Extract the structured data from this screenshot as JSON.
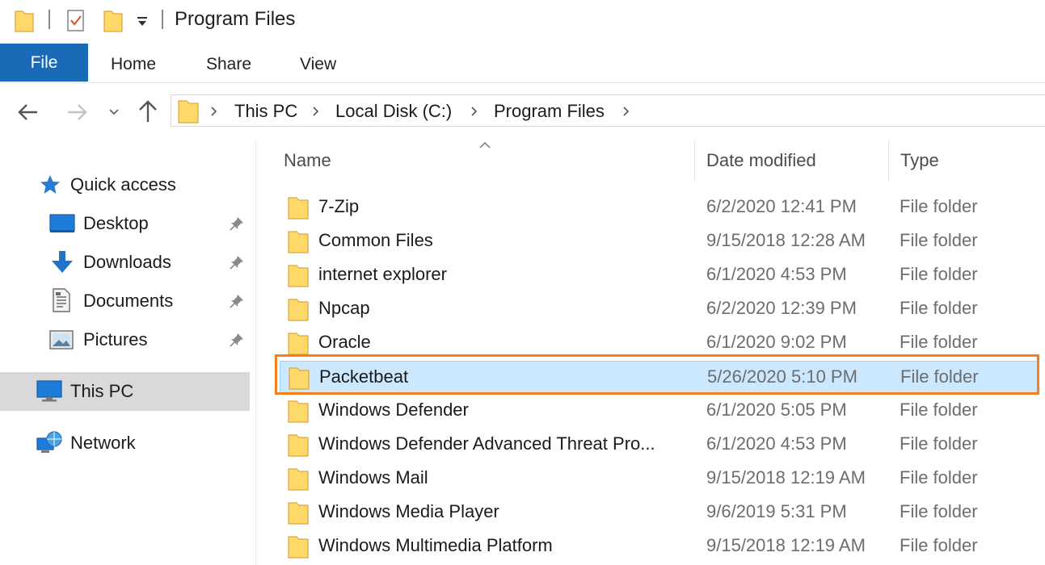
{
  "window": {
    "title": "Program Files"
  },
  "ribbon": {
    "tabs": [
      "File",
      "Home",
      "Share",
      "View"
    ]
  },
  "address": {
    "breadcrumbs": [
      "This PC",
      "Local Disk (C:)",
      "Program Files"
    ]
  },
  "sidebar": {
    "items": [
      {
        "label": "Quick access",
        "icon": "star-icon"
      },
      {
        "label": "Desktop",
        "icon": "desktop-icon",
        "pinned": true
      },
      {
        "label": "Downloads",
        "icon": "download-arrow-icon",
        "pinned": true
      },
      {
        "label": "Documents",
        "icon": "document-icon",
        "pinned": true
      },
      {
        "label": "Pictures",
        "icon": "pictures-icon",
        "pinned": true
      },
      {
        "label": "This PC",
        "icon": "computer-icon",
        "selected": true
      },
      {
        "label": "Network",
        "icon": "network-icon"
      }
    ]
  },
  "list": {
    "columns": [
      "Name",
      "Date modified",
      "Type"
    ],
    "sort_indicator": "ascending",
    "rows": [
      {
        "name": "7-Zip",
        "date": "6/2/2020 12:41 PM",
        "type": "File folder"
      },
      {
        "name": "Common Files",
        "date": "9/15/2018 12:28 AM",
        "type": "File folder"
      },
      {
        "name": "internet explorer",
        "date": "6/1/2020 4:53 PM",
        "type": "File folder"
      },
      {
        "name": "Npcap",
        "date": "6/2/2020 12:39 PM",
        "type": "File folder"
      },
      {
        "name": "Oracle",
        "date": "6/1/2020 9:02 PM",
        "type": "File folder"
      },
      {
        "name": "Packetbeat",
        "date": "5/26/2020 5:10 PM",
        "type": "File folder",
        "selected": true
      },
      {
        "name": "Windows Defender",
        "date": "6/1/2020 5:05 PM",
        "type": "File folder"
      },
      {
        "name": "Windows Defender Advanced Threat Pro...",
        "date": "6/1/2020 4:53 PM",
        "type": "File folder"
      },
      {
        "name": "Windows Mail",
        "date": "9/15/2018 12:19 AM",
        "type": "File folder"
      },
      {
        "name": "Windows Media Player",
        "date": "9/6/2019 5:31 PM",
        "type": "File folder"
      },
      {
        "name": "Windows Multimedia Platform",
        "date": "9/15/2018 12:19 AM",
        "type": "File folder"
      }
    ]
  },
  "colors": {
    "file_tab": "#1a6ab8",
    "selection": "#cce8ff",
    "annotation_box": "#f47f20",
    "folder": "#ffd969"
  }
}
